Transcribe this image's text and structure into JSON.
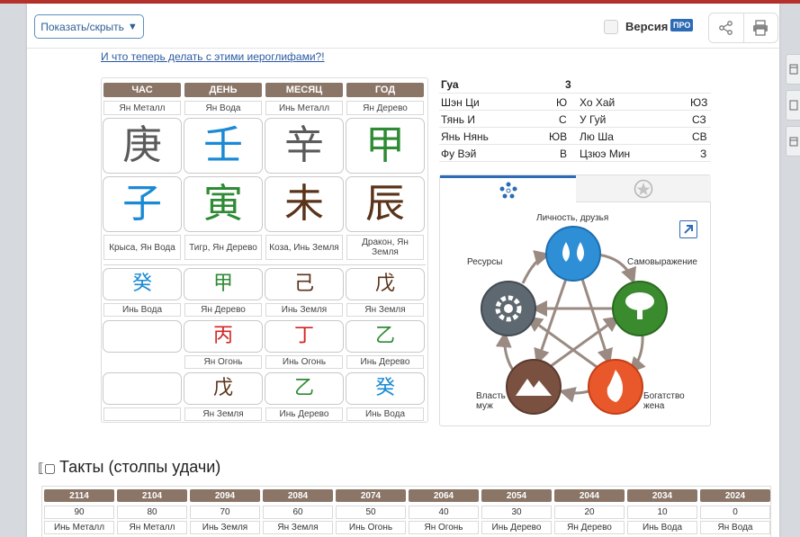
{
  "header": {
    "toggle_label": "Показать/скрыть",
    "toggle_arrow": "▼",
    "version_label": "Версия",
    "pro_badge": "ПРО",
    "icons": [
      "share-icon",
      "print-icon"
    ]
  },
  "link_text": "И что теперь делать с этими иероглифами?!",
  "pillars": {
    "headers": [
      "ЧАС",
      "ДЕНЬ",
      "МЕСЯЦ",
      "ГОД"
    ],
    "stem_labels": [
      "Ян Металл",
      "Ян Вода",
      "Инь Металл",
      "Ян Дерево"
    ],
    "stems": [
      {
        "char": "庚",
        "color": "#5a5a5a"
      },
      {
        "char": "壬",
        "color": "#1a8ad4"
      },
      {
        "char": "辛",
        "color": "#5a5a5a"
      },
      {
        "char": "甲",
        "color": "#2e8b34"
      }
    ],
    "branches": [
      {
        "char": "子",
        "color": "#1a8ad4"
      },
      {
        "char": "寅",
        "color": "#2e8b34"
      },
      {
        "char": "未",
        "color": "#5a3318"
      },
      {
        "char": "辰",
        "color": "#5a3318"
      }
    ],
    "branch_labels": [
      "Крыса, Ян Вода",
      "Тигр, Ян Дерево",
      "Коза, Инь Земля",
      "Дракон, Ян Земля"
    ],
    "hidden_rows": [
      {
        "chars": [
          {
            "char": "癸",
            "color": "#1a8ad4"
          },
          {
            "char": "甲",
            "color": "#2e8b34"
          },
          {
            "char": "己",
            "color": "#5a3318"
          },
          {
            "char": "戊",
            "color": "#5a3318"
          }
        ],
        "labels": [
          "Инь Вода",
          "Ян Дерево",
          "Инь Земля",
          "Ян Земля"
        ]
      },
      {
        "chars": [
          {
            "char": "",
            "color": "#5a5a5a"
          },
          {
            "char": "丙",
            "color": "#d32626"
          },
          {
            "char": "丁",
            "color": "#d32626"
          },
          {
            "char": "乙",
            "color": "#2e8b34"
          }
        ],
        "labels": [
          "",
          "Ян Огонь",
          "Инь Огонь",
          "Инь Дерево"
        ]
      },
      {
        "chars": [
          {
            "char": "",
            "color": "#5a5a5a"
          },
          {
            "char": "戊",
            "color": "#5a3318"
          },
          {
            "char": "乙",
            "color": "#2e8b34"
          },
          {
            "char": "癸",
            "color": "#1a8ad4"
          }
        ],
        "labels": [
          "",
          "Ян Земля",
          "Инь Дерево",
          "Инь Вода"
        ]
      }
    ]
  },
  "gua": {
    "title": "Гуа",
    "value": "3",
    "rows": [
      {
        "left_name": "Шэн Ци",
        "left_dir": "Ю",
        "right_name": "Хо Хай",
        "right_dir": "ЮЗ"
      },
      {
        "left_name": "Тянь И",
        "left_dir": "С",
        "right_name": "У Гуй",
        "right_dir": "СЗ"
      },
      {
        "left_name": "Янь Нянь",
        "left_dir": "ЮВ",
        "right_name": "Лю Ша",
        "right_dir": "СВ"
      },
      {
        "left_name": "Фу Вэй",
        "left_dir": "В",
        "right_name": "Цзюэ Мин",
        "right_dir": "З"
      }
    ]
  },
  "elements": {
    "labels": {
      "top": "Личность, друзья",
      "right": "Самовыражение",
      "left": "Ресурсы",
      "bottom_left": "Власть\nмуж",
      "bottom_right": "Богатство\nжена"
    },
    "colors": {
      "water": "#2f8fd6",
      "wood": "#3a8a2e",
      "fire": "#e8582a",
      "earth": "#7a5040",
      "metal": "#5e6870"
    }
  },
  "luck": {
    "title": "Такты (столпы удачи)",
    "columns": [
      {
        "year": "2114",
        "age": "90",
        "element": "Инь Металл"
      },
      {
        "year": "2104",
        "age": "80",
        "element": "Ян Металл"
      },
      {
        "year": "2094",
        "age": "70",
        "element": "Инь Земля"
      },
      {
        "year": "2084",
        "age": "60",
        "element": "Ян Земля"
      },
      {
        "year": "2074",
        "age": "50",
        "element": "Инь Огонь"
      },
      {
        "year": "2064",
        "age": "40",
        "element": "Ян Огонь"
      },
      {
        "year": "2054",
        "age": "30",
        "element": "Инь Дерево"
      },
      {
        "year": "2044",
        "age": "20",
        "element": "Ян Дерево"
      },
      {
        "year": "2034",
        "age": "10",
        "element": "Инь Вода"
      },
      {
        "year": "2024",
        "age": "0",
        "element": "Ян Вода"
      }
    ]
  }
}
